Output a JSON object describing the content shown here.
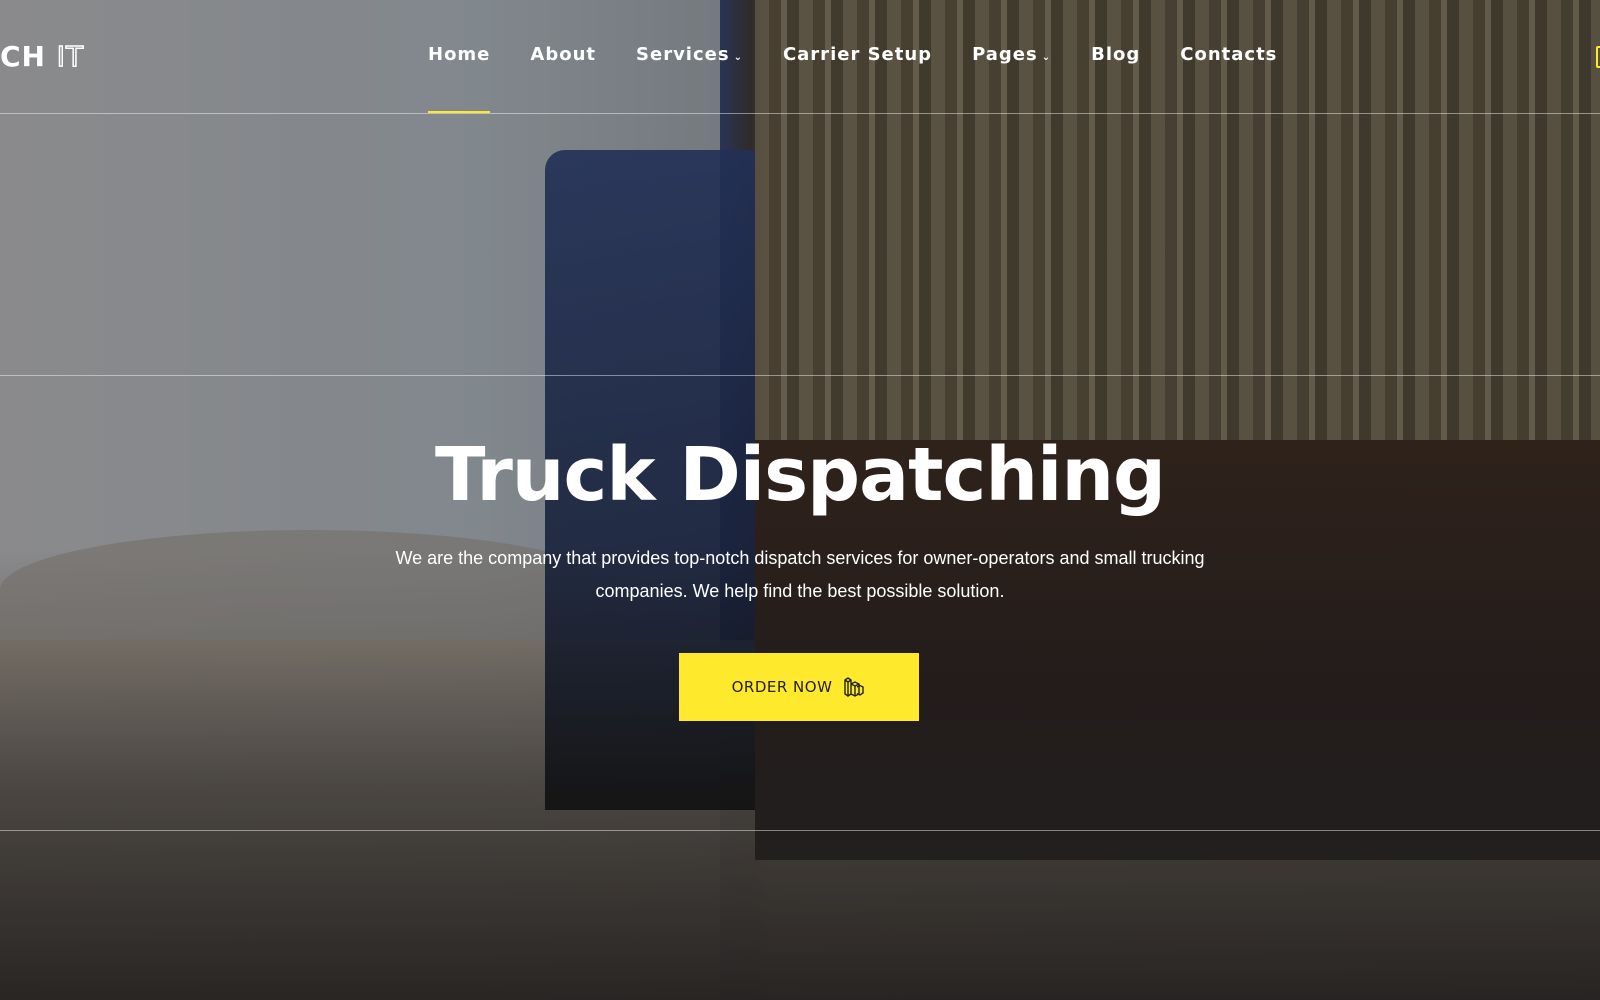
{
  "header": {
    "logo_main": "CH",
    "logo_outline": "IT",
    "nav": [
      {
        "label": "Home",
        "active": true
      },
      {
        "label": "About"
      },
      {
        "label": "Services",
        "dropdown": true
      },
      {
        "label": "Carrier Setup"
      },
      {
        "label": "Pages",
        "dropdown": true
      },
      {
        "label": "Blog"
      },
      {
        "label": "Contacts"
      }
    ]
  },
  "hero": {
    "title": "Truck Dispatching",
    "subtitle": "We are the company that provides top-notch dispatch services for owner-operators and small trucking companies. We help find the best possible solution.",
    "cta_label": "ORDER NOW",
    "cta_icon": "boxes-icon"
  },
  "colors": {
    "accent": "#ffe92d"
  }
}
